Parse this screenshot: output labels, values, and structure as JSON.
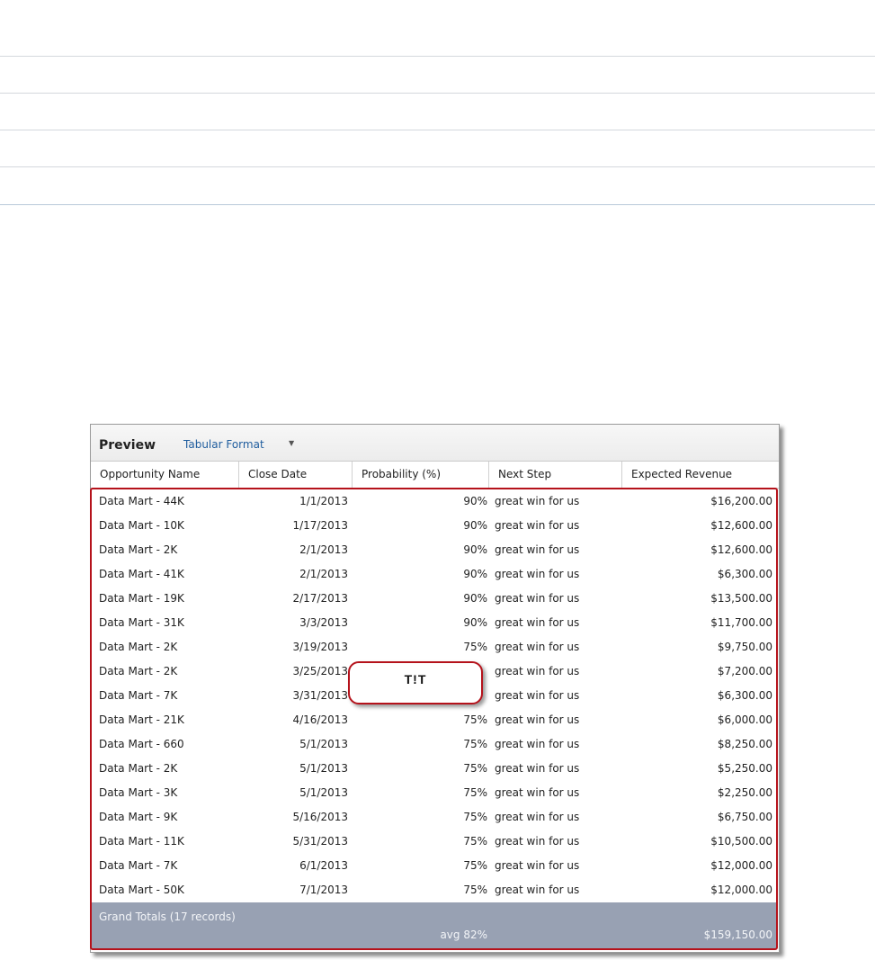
{
  "preview": {
    "title": "Preview",
    "format_label": "Tabular Format",
    "format_caret": "▼"
  },
  "columns": [
    "Opportunity Name",
    "Close Date",
    "Probability (%)",
    "Next Step",
    "Expected Revenue"
  ],
  "rows": [
    {
      "name": "Data Mart - 44K",
      "date": "1/1/2013",
      "prob": "90%",
      "step": "great win for us",
      "rev": "$16,200.00"
    },
    {
      "name": "Data Mart - 10K",
      "date": "1/17/2013",
      "prob": "90%",
      "step": "great win for us",
      "rev": "$12,600.00"
    },
    {
      "name": "Data Mart - 2K",
      "date": "2/1/2013",
      "prob": "90%",
      "step": "great win for us",
      "rev": "$12,600.00"
    },
    {
      "name": "Data Mart - 41K",
      "date": "2/1/2013",
      "prob": "90%",
      "step": "great win for us",
      "rev": "$6,300.00"
    },
    {
      "name": "Data Mart - 19K",
      "date": "2/17/2013",
      "prob": "90%",
      "step": "great win for us",
      "rev": "$13,500.00"
    },
    {
      "name": "Data Mart - 31K",
      "date": "3/3/2013",
      "prob": "90%",
      "step": "great win for us",
      "rev": "$11,700.00"
    },
    {
      "name": "Data Mart - 2K",
      "date": "3/19/2013",
      "prob": "75%",
      "step": "great win for us",
      "rev": "$9,750.00"
    },
    {
      "name": "Data Mart - 2K",
      "date": "3/25/2013",
      "prob": "",
      "step": "great win for us",
      "rev": "$7,200.00"
    },
    {
      "name": "Data Mart - 7K",
      "date": "3/31/2013",
      "prob": "",
      "step": "great win for us",
      "rev": "$6,300.00"
    },
    {
      "name": "Data Mart - 21K",
      "date": "4/16/2013",
      "prob": "75%",
      "step": "great win for us",
      "rev": "$6,000.00"
    },
    {
      "name": "Data Mart - 660",
      "date": "5/1/2013",
      "prob": "75%",
      "step": "great win for us",
      "rev": "$8,250.00"
    },
    {
      "name": "Data Mart - 2K",
      "date": "5/1/2013",
      "prob": "75%",
      "step": "great win for us",
      "rev": "$5,250.00"
    },
    {
      "name": "Data Mart - 3K",
      "date": "5/1/2013",
      "prob": "75%",
      "step": "great win for us",
      "rev": "$2,250.00"
    },
    {
      "name": "Data Mart - 9K",
      "date": "5/16/2013",
      "prob": "75%",
      "step": "great win for us",
      "rev": "$6,750.00"
    },
    {
      "name": "Data Mart - 11K",
      "date": "5/31/2013",
      "prob": "75%",
      "step": "great win for us",
      "rev": "$10,500.00"
    },
    {
      "name": "Data Mart - 7K",
      "date": "6/1/2013",
      "prob": "75%",
      "step": "great win for us",
      "rev": "$12,000.00"
    },
    {
      "name": "Data Mart - 50K",
      "date": "7/1/2013",
      "prob": "75%",
      "step": "great win for us",
      "rev": "$12,000.00"
    }
  ],
  "totals": {
    "label": "Grand Totals (17 records)",
    "avg": "avg 82%",
    "sum": "$159,150.00"
  },
  "callout": {
    "text": "T!T"
  },
  "colors": {
    "highlight_red": "#b5121b",
    "totals_bg": "#98a1b3",
    "link_blue": "#1f5d9e"
  }
}
